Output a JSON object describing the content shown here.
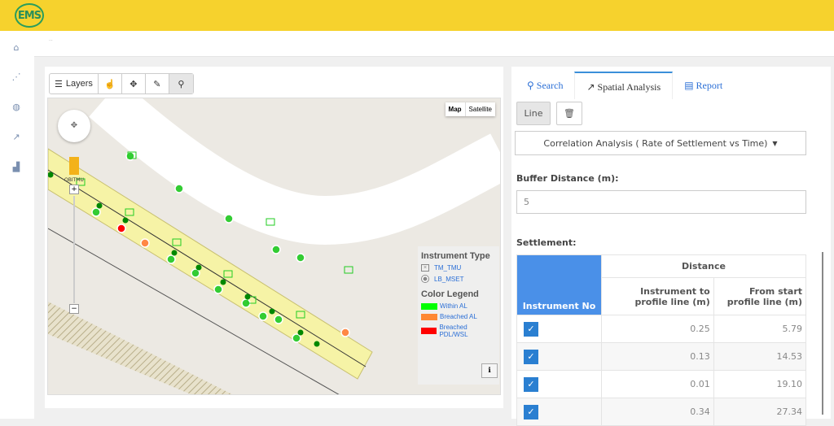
{
  "app": {
    "logo": "EMS",
    "breadcrumb": "..."
  },
  "sidebar": {
    "items": [
      {
        "icon": "home-icon"
      },
      {
        "icon": "network-icon"
      },
      {
        "icon": "globe-icon"
      },
      {
        "icon": "line-chart-icon"
      },
      {
        "icon": "bar-chart-icon"
      }
    ]
  },
  "map": {
    "toolbar": {
      "layers": "Layers"
    },
    "map_type": {
      "map": "Map",
      "satellite": "Satellite",
      "selected": "Map"
    },
    "zoom_label": "OBITMU",
    "legend": {
      "instrument_type_title": "Instrument Type",
      "instrument_types": [
        "TM_TMU",
        "LB_MSET"
      ],
      "color_legend_title": "Color Legend",
      "colors": [
        {
          "label": "Within AL",
          "color": "#00ff00"
        },
        {
          "label": "Breached AL",
          "color": "#ff8833"
        },
        {
          "label": "Breached PDL/WSL",
          "color": "#ff0000"
        }
      ]
    }
  },
  "panel": {
    "tabs": [
      {
        "label": "Search"
      },
      {
        "label": "Spatial Analysis",
        "active": true
      },
      {
        "label": "Report"
      }
    ],
    "line_button": "Line",
    "analysis_dropdown": "Correlation Analysis ( Rate of Settlement vs Time)",
    "buffer_label": "Buffer Distance (m):",
    "buffer_value": "5",
    "settlement_label": "Settlement:",
    "table": {
      "col_instrument": "Instrument No",
      "group_distance": "Distance",
      "col_to_profile": "Instrument to profile line (m)",
      "col_from_start": "From start profile line (m)",
      "rows": [
        {
          "checked": true,
          "to_profile": "0.25",
          "from_start": "5.79"
        },
        {
          "checked": true,
          "to_profile": "0.13",
          "from_start": "14.53"
        },
        {
          "checked": true,
          "to_profile": "0.01",
          "from_start": "19.10"
        },
        {
          "checked": true,
          "to_profile": "0.34",
          "from_start": "27.34"
        }
      ]
    }
  }
}
